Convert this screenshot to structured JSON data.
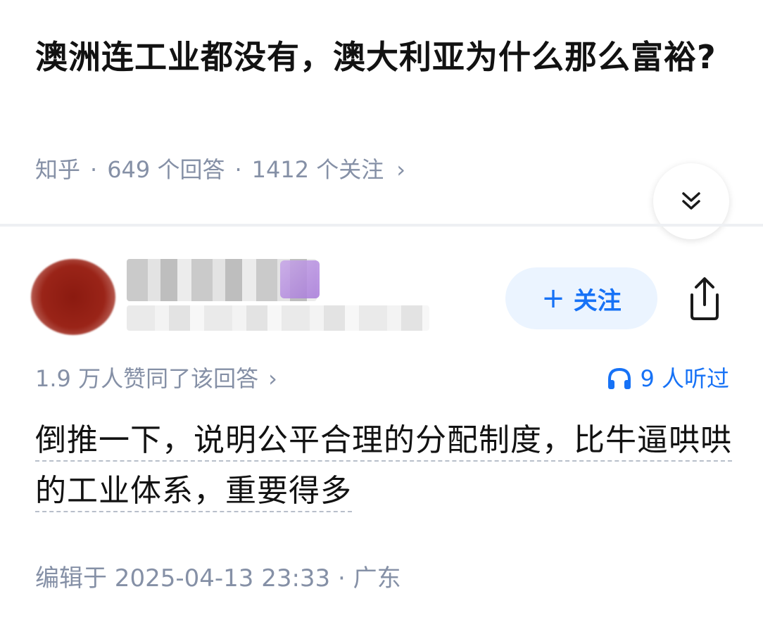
{
  "question": {
    "title": "澳洲连工业都没有，澳大利亚为什么那么富裕?",
    "source": "知乎",
    "answers": "649 个回答",
    "followers": "1412 个关注",
    "meta_chevron": "›"
  },
  "author": {
    "follow_label": "关注",
    "follow_plus": "+"
  },
  "stats": {
    "approvals": "1.9 万人赞同了该回答",
    "approvals_chevron": "›",
    "listened": "9 人听过"
  },
  "answer": {
    "content": "倒推一下，说明公平合理的分配制度，比牛逼哄哄的工业体系，重要得多",
    "edited": "编辑于 2025-04-13 23:33 · 广东"
  },
  "icons": {
    "collapse": "double-chevron-down-icon",
    "share": "share-icon",
    "audio": "headphones-icon"
  },
  "colors": {
    "accent": "#1772f6",
    "follow_bg": "#ebf4ff",
    "meta_gray": "#8590a6"
  }
}
